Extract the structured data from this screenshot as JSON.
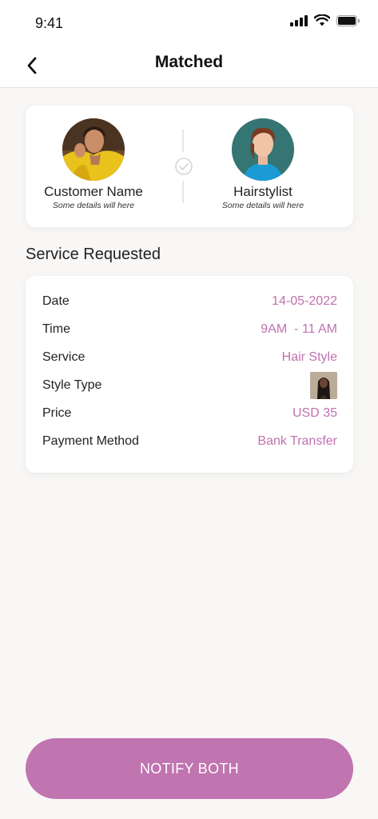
{
  "status_bar": {
    "time": "9:41",
    "icons": [
      "signal-icon",
      "wifi-icon",
      "battery-icon"
    ]
  },
  "nav": {
    "title": "Matched",
    "back_icon": "chevron-left-icon"
  },
  "match": {
    "customer": {
      "name": "Customer Name",
      "details": "Some details will here"
    },
    "stylist": {
      "name": "Hairstylist",
      "details": "Some details will here"
    },
    "center_icon": "check-circle-icon"
  },
  "service": {
    "section_title": "Service Requested",
    "rows": [
      {
        "label": "Date",
        "value": "14-05-2022"
      },
      {
        "label": "Time",
        "value": "9AM  - 11 AM"
      },
      {
        "label": "Service",
        "value": "Hair Style"
      },
      {
        "label": "Style Type",
        "value": ""
      },
      {
        "label": "Price",
        "value": "USD 35"
      },
      {
        "label": "Payment Method",
        "value": "Bank Transfer"
      }
    ]
  },
  "actions": {
    "notify_label": "NOTIFY BOTH"
  },
  "colors": {
    "accent": "#c074b0",
    "value_text": "#c171b0",
    "background": "#f8f7f6"
  }
}
